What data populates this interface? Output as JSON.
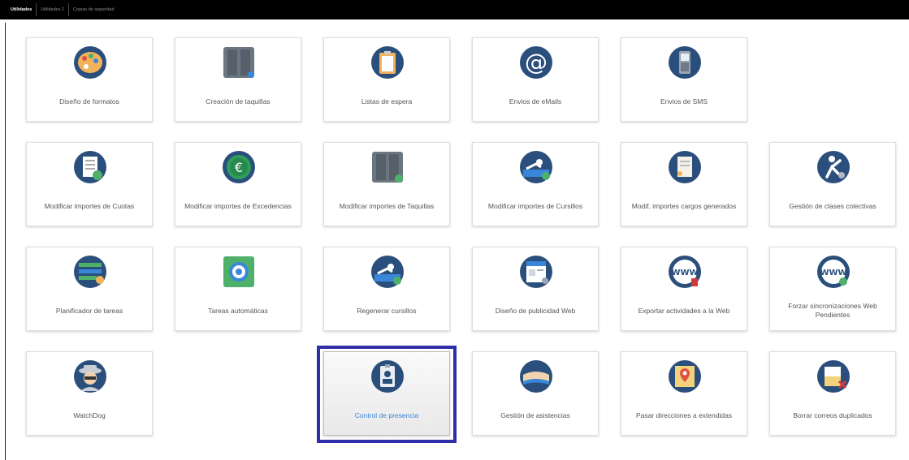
{
  "tabs": [
    "Utilidades",
    "Utilidades 2",
    "Copias de seguridad"
  ],
  "tiles": {
    "diseno_formatos": "Diseño de formatos",
    "creacion_taquillas": "Creación de taquillas",
    "listas_espera": "Listas de espera",
    "envios_emails": "Envios de eMails",
    "envios_sms": "Envios de SMS",
    "mod_cuotas": "Modificar importes de Cuotas",
    "mod_excedencias": "Modificar importes de Excedencias",
    "mod_taquillas": "Modificar importes de Taquillas",
    "mod_cursillos": "Modificar importes de Cursillos",
    "mod_cargos": "Modif. importes cargos generados",
    "clases_colectivas": "Gestión de clases colectivas",
    "planificador": "Planificador de tareas",
    "tareas_auto": "Tareas automáticas",
    "regenerar_cursillos": "Regenerar cursillos",
    "publicidad_web": "Diseño de publicidad Web",
    "exportar_web": "Exportar actividades a la Web",
    "forzar_sync": "Forzar sincronizaciones Web Pendientes",
    "watchdog": "WatchDog",
    "control_presencia": "Control de presencia",
    "gestion_asistencias": "Gestión de asistencias",
    "pasar_direcciones": "Pasar direcciones a extendidas",
    "borrar_correos": "Borrar correos duplicados"
  },
  "icons": {
    "diseno_formatos": "palette-icon",
    "creacion_taquillas": "locker-icon",
    "listas_espera": "clipboard-icon",
    "envios_emails": "at-sign-icon",
    "envios_sms": "mobile-phone-icon",
    "mod_cuotas": "document-edit-icon",
    "mod_excedencias": "euro-coin-icon",
    "mod_taquillas": "locker-edit-icon",
    "mod_cursillos": "swimmer-edit-icon",
    "mod_cargos": "receipt-icon",
    "clases_colectivas": "fitness-class-icon",
    "planificador": "task-planner-icon",
    "tareas_auto": "gear-icon",
    "regenerar_cursillos": "swimmer-refresh-icon",
    "publicidad_web": "web-page-icon",
    "exportar_web": "www-export-icon",
    "forzar_sync": "www-sync-icon",
    "watchdog": "detective-icon",
    "control_presencia": "id-badge-icon",
    "gestion_asistencias": "hands-icon",
    "pasar_direcciones": "map-pin-icon",
    "borrar_correos": "delete-mail-icon"
  },
  "colors": {
    "icon_circle": "#2b4f7c",
    "highlight_border": "#2e2ea8",
    "selected_label": "#3a86d8"
  }
}
